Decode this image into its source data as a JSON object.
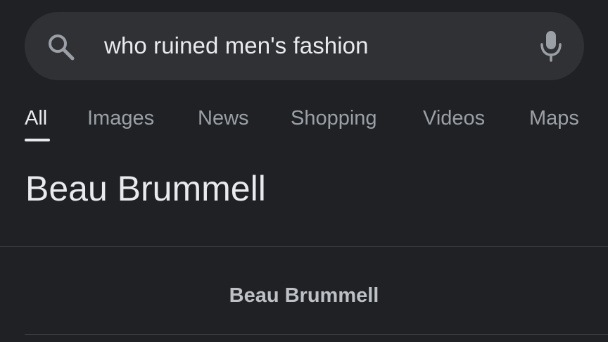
{
  "search": {
    "query": "who ruined men's fashion",
    "left_icon": "search-icon",
    "right_icon": "mic-icon"
  },
  "tabs": [
    {
      "label": "All",
      "active": true
    },
    {
      "label": "Images",
      "active": false
    },
    {
      "label": "News",
      "active": false
    },
    {
      "label": "Shopping",
      "active": false
    },
    {
      "label": "Videos",
      "active": false
    },
    {
      "label": "Maps",
      "active": false
    }
  ],
  "answer": {
    "heading": "Beau Brummell",
    "result_title": "Beau Brummell"
  },
  "colors": {
    "background": "#202124",
    "search_bar": "#303134",
    "text_primary": "#e8eaed",
    "text_secondary": "#9aa0a6",
    "divider": "#3c4043"
  }
}
